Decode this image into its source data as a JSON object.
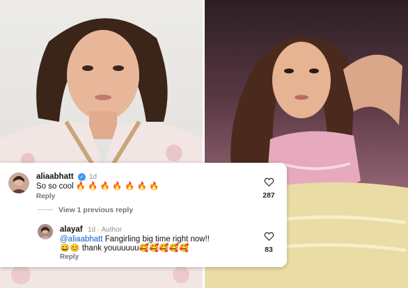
{
  "comment": {
    "username": "aliaabhatt",
    "time": "1d",
    "text": "So so cool 🔥 🔥 🔥 🔥 🔥 🔥 🔥",
    "reply_label": "Reply",
    "like_count": "287"
  },
  "view_replies": "View 1 previous reply",
  "reply": {
    "username": "alayaf",
    "time": "1d",
    "author_badge": "Author",
    "mention": "@aliaabhatt",
    "line1": " Fangirling big time right now!!",
    "line2": "😄😊 thank youuuuuu🥰🥰🥰🥰🥰",
    "reply_label": "Reply",
    "like_count": "83"
  },
  "colors": {
    "verified": "#3797f0",
    "mention": "#0b5fd1"
  },
  "icons": {
    "like": "heart-outline-icon",
    "verified": "verified-badge-icon"
  }
}
